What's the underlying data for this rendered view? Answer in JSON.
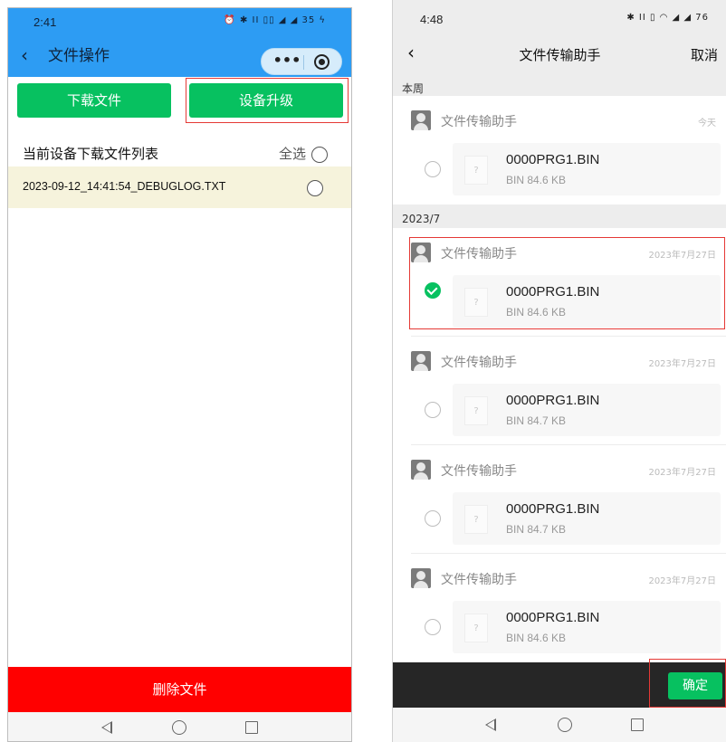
{
  "left": {
    "status_bar": {
      "time": "2:41",
      "icons": "⏰ ✱ ⅠⅠ ▯▯ ◢ ◢ 35 ϟ",
      "battery": "35"
    },
    "nav": {
      "back_glyph": "‹",
      "title": "文件操作",
      "capsule_dots": "•••"
    },
    "buttons": {
      "download": "下载文件",
      "upgrade": "设备升级",
      "delete": "删除文件"
    },
    "file_list": {
      "heading": "当前设备下载文件列表",
      "select_all": "全选",
      "files": [
        {
          "name": "2023-09-12_14:41:54_DEBUGLOG.TXT",
          "selected": false
        }
      ]
    },
    "highlight_color": "#e53935",
    "accent_color": "#2d9cf3"
  },
  "right": {
    "status_bar": {
      "time": "4:48",
      "icons": "✱ ⅠⅠ ▯ ◠ ◢ ◢ 76",
      "battery": "76"
    },
    "nav": {
      "back_glyph": "‹",
      "title": "文件传输助手",
      "cancel": "取消"
    },
    "sections": [
      {
        "label": "本周"
      },
      {
        "label": "2023/7"
      }
    ],
    "messages": [
      {
        "sender": "文件传输助手",
        "date": "今天",
        "file_name": "0000PRG1.BIN",
        "file_meta": "BIN 84.6 KB",
        "selected": false
      },
      {
        "sender": "文件传输助手",
        "date": "2023年7月27日",
        "file_name": "0000PRG1.BIN",
        "file_meta": "BIN 84.6 KB",
        "selected": true
      },
      {
        "sender": "文件传输助手",
        "date": "2023年7月27日",
        "file_name": "0000PRG1.BIN",
        "file_meta": "BIN 84.7 KB",
        "selected": false
      },
      {
        "sender": "文件传输助手",
        "date": "2023年7月27日",
        "file_name": "0000PRG1.BIN",
        "file_meta": "BIN 84.7 KB",
        "selected": false
      },
      {
        "sender": "文件传输助手",
        "date": "2023年7月27日",
        "file_name": "0000PRG1.BIN",
        "file_meta": "BIN 84.6 KB",
        "selected": false
      }
    ],
    "unknown_file_glyph": "?",
    "confirm": "确定",
    "brand_color": "#07c160"
  }
}
